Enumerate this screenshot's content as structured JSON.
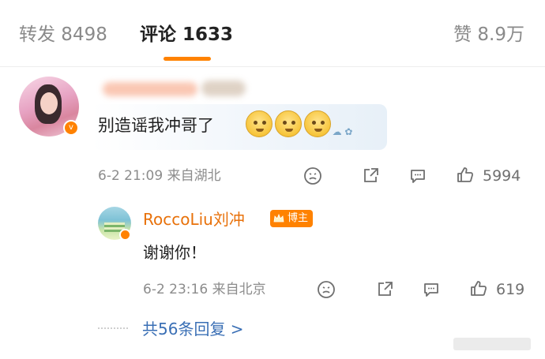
{
  "tabs": {
    "repost": "转发 8498",
    "comment": "评论 1633",
    "like": "赞 8.9万"
  },
  "colors": {
    "accent": "#ff8200",
    "link": "#3a6fb5",
    "host_name": "#e8710a"
  },
  "comment": {
    "text": "别造谣我冲哥了",
    "emojis": [
      "crying-face-emoji",
      "crying-face-emoji",
      "crying-face-emoji"
    ],
    "meta": "6-2 21:09 来自湖北",
    "like_count": "5994",
    "icons": [
      "dislike-icon",
      "share-icon",
      "comment-icon",
      "like-icon"
    ]
  },
  "reply": {
    "author": "RoccoLiu刘冲",
    "badge": "博主",
    "text": "谢谢你！",
    "meta": "6-2 23:16 来自北京",
    "like_count": "619"
  },
  "more_replies": "共56条回复 >"
}
